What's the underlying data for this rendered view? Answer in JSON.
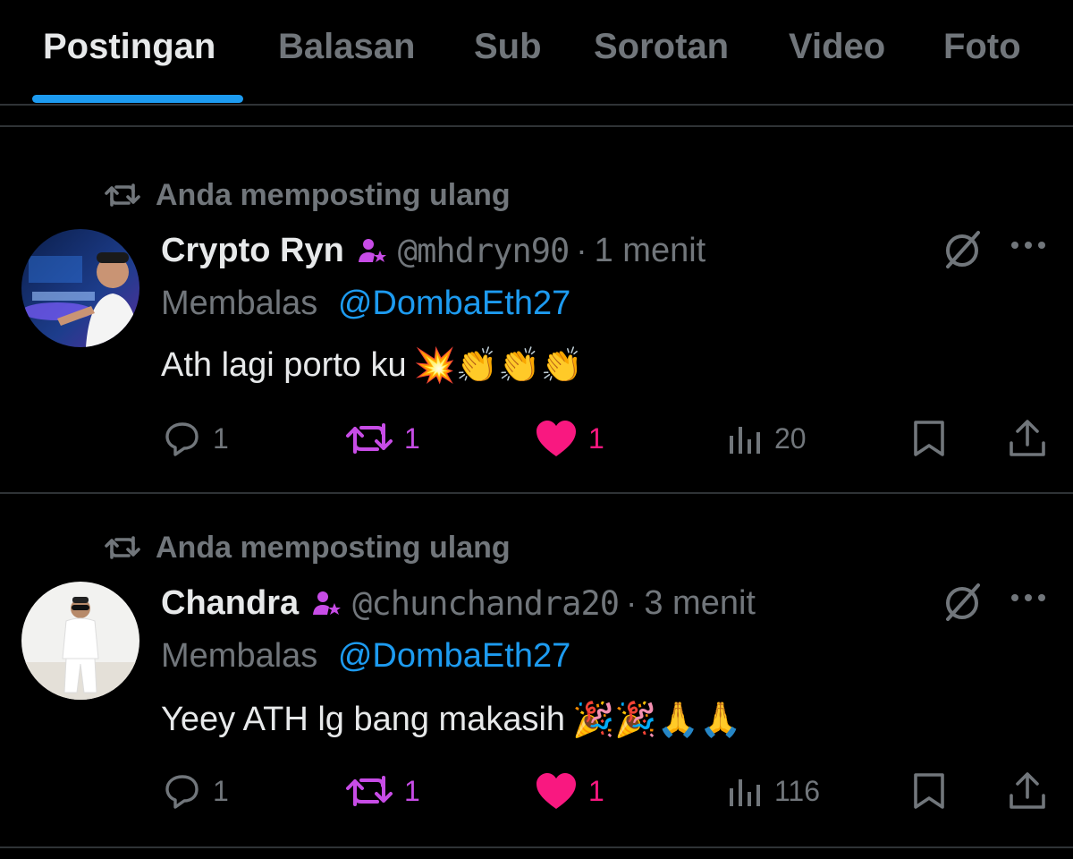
{
  "tabs": [
    {
      "label": "Postingan",
      "active": true
    },
    {
      "label": "Balasan"
    },
    {
      "label": "Sub"
    },
    {
      "label": "Sorotan"
    },
    {
      "label": "Video"
    },
    {
      "label": "Foto"
    }
  ],
  "colors": {
    "accent": "#1d9bf0",
    "muted": "#71767b",
    "retweet": "#c74ce6",
    "like": "#f91880",
    "background": "#000000"
  },
  "posts": [
    {
      "repost_label": "Anda memposting ulang",
      "display_name": "Crypto Ryn",
      "handle": "@mhdryn90",
      "separator": "·",
      "time": "1 menit",
      "reply_prefix": "Membalas",
      "reply_mention": "@DombaEth27",
      "text": "Ath lagi porto ku",
      "emojis": "💥👏👏👏",
      "stats": {
        "replies": "1",
        "reposts": "1",
        "likes": "1",
        "views": "20"
      },
      "icons": {
        "verified": "subscriber-badge-icon",
        "grok": "grok-icon",
        "more": "more-icon"
      }
    },
    {
      "repost_label": "Anda memposting ulang",
      "display_name": "Chandra",
      "handle": "@chunchandra20",
      "separator": "·",
      "time": "3 menit",
      "reply_prefix": "Membalas",
      "reply_mention": "@DombaEth27",
      "text": "Yeey ATH lg bang makasih",
      "emojis": "🎉🎉🙏🙏",
      "stats": {
        "replies": "1",
        "reposts": "1",
        "likes": "1",
        "views": "116"
      },
      "icons": {
        "verified": "subscriber-badge-icon",
        "grok": "grok-icon",
        "more": "more-icon"
      }
    }
  ]
}
